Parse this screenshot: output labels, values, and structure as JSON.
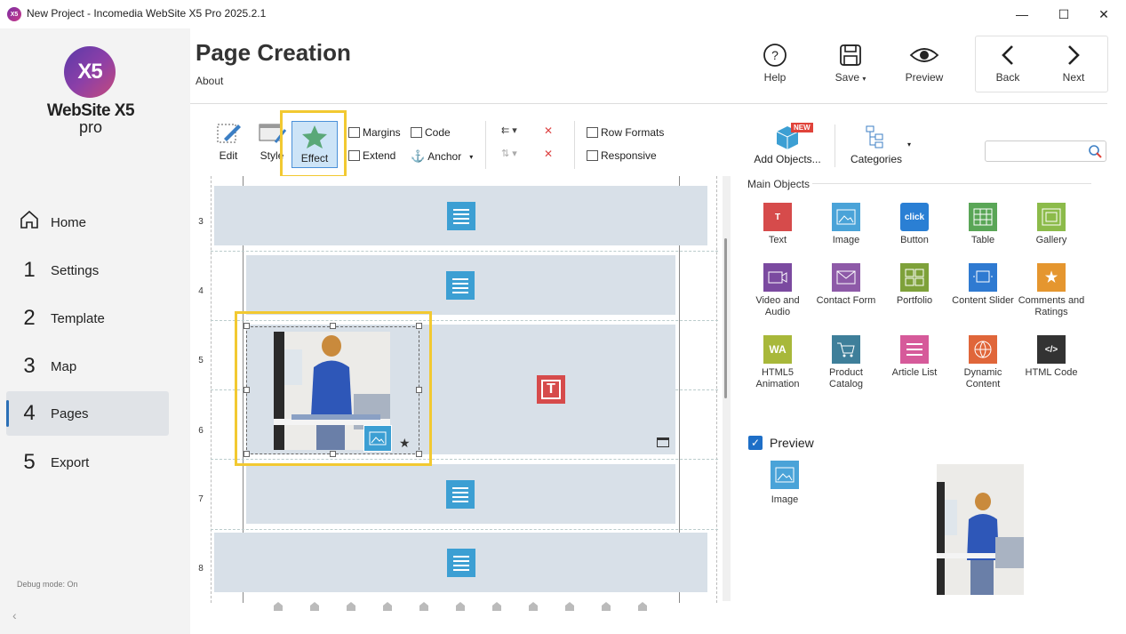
{
  "window": {
    "title": "New Project - Incomedia WebSite X5 Pro 2025.2.1",
    "logo": "X5",
    "minimize": "—",
    "maximize": "☐",
    "close": "✕"
  },
  "brand": {
    "name": "WebSite X5",
    "edition": "pro",
    "mark": "X5"
  },
  "nav": [
    {
      "num": "",
      "label": "Home"
    },
    {
      "num": "1",
      "label": "Settings"
    },
    {
      "num": "2",
      "label": "Template"
    },
    {
      "num": "3",
      "label": "Map"
    },
    {
      "num": "4",
      "label": "Pages"
    },
    {
      "num": "5",
      "label": "Export"
    }
  ],
  "debug": "Debug mode: On",
  "header": {
    "title": "Page Creation",
    "subtitle": "About"
  },
  "toolbar": {
    "help": "Help",
    "save": "Save",
    "preview": "Preview",
    "back": "Back",
    "next": "Next"
  },
  "ribbon": {
    "edit": "Edit",
    "style": "Style",
    "effect": "Effect",
    "margins": "Margins",
    "extend": "Extend",
    "code": "Code",
    "anchor": "Anchor",
    "row_formats": "Row Formats",
    "responsive": "Responsive",
    "add_objects": "Add Objects...",
    "new_badge": "NEW",
    "categories": "Categories"
  },
  "grid": {
    "row_numbers": [
      "3",
      "4",
      "5",
      "6",
      "7",
      "8"
    ]
  },
  "objects": {
    "section": "Main Objects",
    "items": [
      {
        "label": "Text",
        "color": "#d64b4b",
        "glyph": "T"
      },
      {
        "label": "Image",
        "color": "#4aa3d8",
        "glyph": ""
      },
      {
        "label": "Button",
        "color": "#2a7fd4",
        "glyph": "click"
      },
      {
        "label": "Table",
        "color": "#5aa657",
        "glyph": ""
      },
      {
        "label": "Gallery",
        "color": "#8cbb4a",
        "glyph": ""
      },
      {
        "label": "Video and Audio",
        "color": "#7b4aa0",
        "glyph": ""
      },
      {
        "label": "Contact Form",
        "color": "#8e5aa8",
        "glyph": ""
      },
      {
        "label": "Portfolio",
        "color": "#7ea13a",
        "glyph": ""
      },
      {
        "label": "Content Slider",
        "color": "#2f7ad1",
        "glyph": ""
      },
      {
        "label": "Comments and Ratings",
        "color": "#e5962f",
        "glyph": "★"
      },
      {
        "label": "HTML5 Animation",
        "color": "#a8b83a",
        "glyph": "WA"
      },
      {
        "label": "Product Catalog",
        "color": "#3e7f9a",
        "glyph": ""
      },
      {
        "label": "Article List",
        "color": "#d65a9a",
        "glyph": ""
      },
      {
        "label": "Dynamic Content",
        "color": "#e0663a",
        "glyph": ""
      },
      {
        "label": "HTML Code",
        "color": "#333333",
        "glyph": "</>"
      }
    ]
  },
  "preview": {
    "checkbox_label": "Preview",
    "selected_object": "Image"
  }
}
